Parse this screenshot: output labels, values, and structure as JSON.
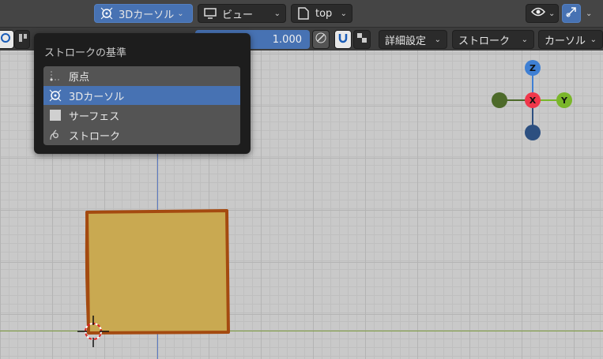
{
  "header": {
    "pivot_button": "3Dカーソル",
    "view_menu": "ビュー",
    "view_name": "top"
  },
  "toolbar": {
    "strength_value": "1.000",
    "advanced_menu": "詳細設定",
    "stroke_menu": "ストローク",
    "cursor_menu": "カーソル"
  },
  "popup": {
    "title": "ストロークの基準",
    "items": [
      {
        "label": "原点",
        "icon": "origin-icon",
        "selected": false
      },
      {
        "label": "3Dカーソル",
        "icon": "cursor-icon",
        "selected": true
      },
      {
        "label": "サーフェス",
        "icon": "surface-icon",
        "selected": false
      },
      {
        "label": "ストローク",
        "icon": "stroke-icon",
        "selected": false
      }
    ]
  },
  "gizmo": {
    "z_label": "Z",
    "x_label": "X",
    "y_label": "Y"
  },
  "colors": {
    "accent": "#4772b3",
    "fill": "#c9a951",
    "outline": "#a44a10",
    "axis_x": "#f0374b",
    "axis_y": "#7ab62a",
    "axis_z": "#3e7fd4"
  }
}
